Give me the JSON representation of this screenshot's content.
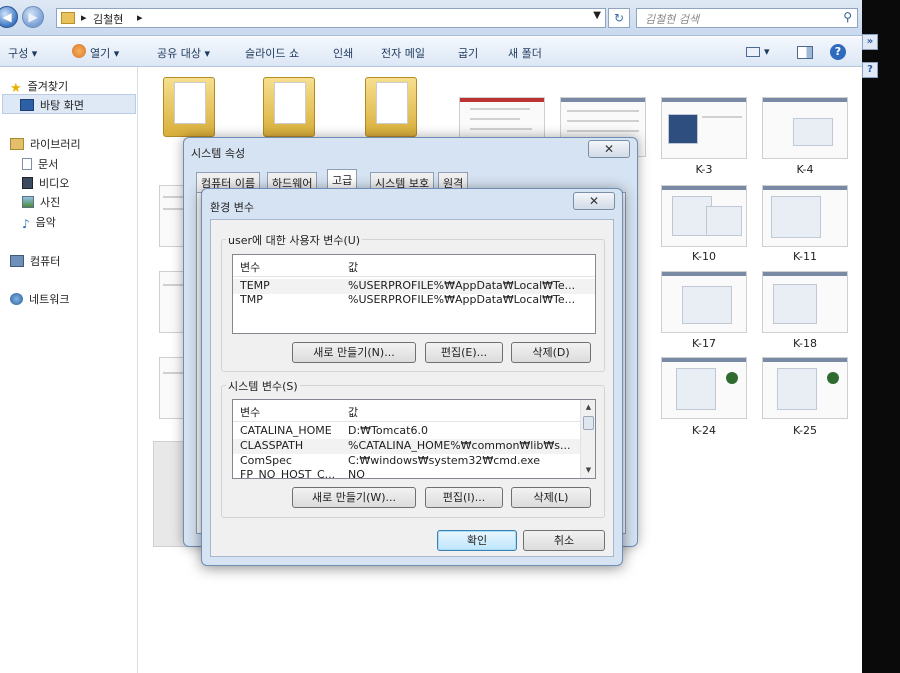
{
  "address": {
    "crumb": "김철현",
    "search_placeholder": "김철현 검색"
  },
  "toolbar": {
    "organize": "구성 ▾",
    "open": "열기 ▾",
    "share": "공유 대상 ▾",
    "slideshow": "슬라이드 쇼",
    "print": "인쇄",
    "email": "전자 메일",
    "burn": "굽기",
    "new_folder": "새 폴더"
  },
  "nav": {
    "favorites": "즐겨찾기",
    "desktop": "바탕 화면",
    "libraries": "라이브러리",
    "documents": "문서",
    "videos": "비디오",
    "pictures": "사진",
    "music": "음악",
    "computer": "컴퓨터",
    "network": "네트워크"
  },
  "thumbnails": [
    "K-3",
    "K-4",
    "K-10",
    "K-11",
    "K-17",
    "K-18",
    "K-24",
    "K-25"
  ],
  "system_props": {
    "title": "시스템 속성",
    "tabs": [
      "컴퓨터 이름",
      "하드웨어",
      "고급",
      "시스템 보호",
      "원격"
    ]
  },
  "env_dialog": {
    "title": "환경 변수",
    "user_group": "user에 대한 사용자 변수(U)",
    "col_var": "변수",
    "col_val": "값",
    "user_vars": [
      {
        "name": "TEMP",
        "value": "%USERPROFILE%₩AppData₩Local₩Te..."
      },
      {
        "name": "TMP",
        "value": "%USERPROFILE%₩AppData₩Local₩Te..."
      }
    ],
    "user_buttons": {
      "new": "새로 만들기(N)...",
      "edit": "편집(E)...",
      "delete": "삭제(D)"
    },
    "sys_group": "시스템 변수(S)",
    "sys_vars": [
      {
        "name": "CATALINA_HOME",
        "value": "D:₩Tomcat6.0"
      },
      {
        "name": "CLASSPATH",
        "value": "%CATALINA_HOME%₩common₩lib₩s..."
      },
      {
        "name": "ComSpec",
        "value": "C:₩windows₩system32₩cmd.exe"
      },
      {
        "name": "FP_NO_HOST_C...",
        "value": "NO"
      }
    ],
    "sys_buttons": {
      "new": "새로 만들기(W)...",
      "edit": "편집(I)...",
      "delete": "삭제(L)"
    },
    "ok": "확인",
    "cancel": "취소"
  },
  "icons": {
    "back": "back-arrow-icon",
    "forward": "forward-arrow-icon",
    "refresh": "refresh-icon",
    "search": "search-icon",
    "close": "close-icon",
    "help": "help-icon"
  },
  "colors": {
    "accent": "#3c7fb1",
    "selection": "#dfe9f6",
    "folder": "#e8c25a"
  }
}
